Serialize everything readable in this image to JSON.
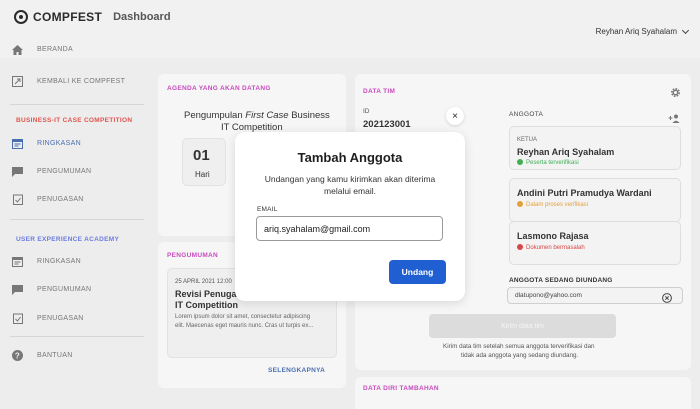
{
  "header": {
    "brand": "COMPFEST",
    "brand_sub": "Dashboard",
    "user_name": "Reyhan Ariq Syahalam"
  },
  "sidebar": {
    "beranda": "BERANDA",
    "kembali": "KEMBALI KE COMPFEST",
    "section1": "BUSINESS-IT CASE COMPETITION",
    "section1_color": "#e0554e",
    "s1_items": [
      "RINGKASAN",
      "PENGUMUMAN",
      "PENUGASAN"
    ],
    "section2": "USER EXPERIENCE ACADEMY",
    "section2_color": "#6b7be0",
    "s2_items": [
      "RINGKASAN",
      "PENGUMUMAN",
      "PENUGASAN"
    ],
    "bantuan": "BANTUAN"
  },
  "agenda": {
    "title": "AGENDA YANG AKAN DATANG",
    "event_pre": "Pengumpulan ",
    "event_em": "First Case",
    "event_post": " Business",
    "event_line2": "IT Competition",
    "count": "01",
    "unit": "Hari"
  },
  "pengumuman": {
    "title": "PENGUMUMAN",
    "date": "25 APRIL 2021 12:00",
    "headline1": "Revisi Penugas",
    "headline2": "IT Competition",
    "body1": "Lorem ipsum dolor sit amet, consectetur adipiscing",
    "body2": "elit. Maecenas eget mauris nunc. Cras ut turpis ex...",
    "more": "SELENGKAPNYA"
  },
  "tim": {
    "title": "DATA TIM",
    "id_label": "ID",
    "id_value": "202123001",
    "anggota_label": "ANGGOTA",
    "members": [
      {
        "role": "KETUA",
        "name": "Reyhan Ariq Syahalam",
        "status": "Peserta terverifikasi",
        "color": "#3fae55"
      },
      {
        "role": "",
        "name": "Andini Putri Pramudya Wardani",
        "status": "Dalam proses verifikasi",
        "color": "#e3a13a"
      },
      {
        "role": "",
        "name": "Lasmono Rajasa",
        "status": "Dokumen bermasalah",
        "color": "#d84848"
      }
    ],
    "invited_label": "ANGGOTA SEDANG DIUNDANG",
    "invited_email": "dlatupono@yahoo.com",
    "submit_label": "Kirim data tim",
    "note1": "Kirim data tim setelah semua anggota terverifikasi dan",
    "note2": "tidak ada anggota yang sedang diundang."
  },
  "extra": {
    "title": "DATA DIRI TAMBAHAN"
  },
  "modal": {
    "title": "Tambah Anggota",
    "desc1": "Undangan yang kamu kirimkan akan diterima",
    "desc2": "melalui email.",
    "email_label": "EMAIL",
    "email_value": "ariq.syahalam@gmail.com",
    "submit": "Undang",
    "close": "×"
  }
}
